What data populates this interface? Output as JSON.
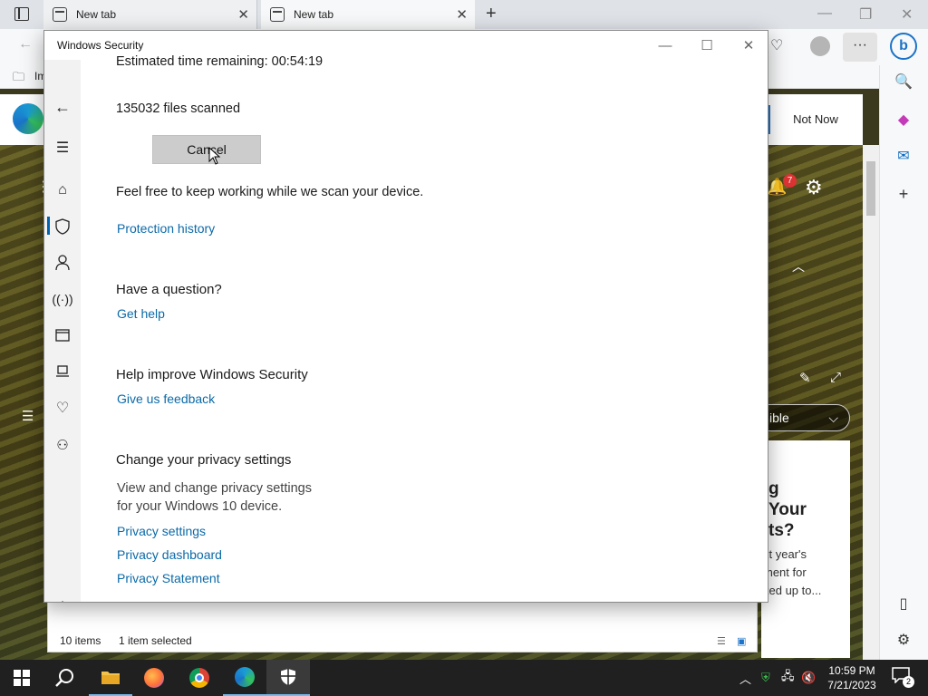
{
  "browser": {
    "tabs": [
      {
        "label": "New tab"
      },
      {
        "label": "New tab"
      }
    ],
    "fav_fragment": "Im",
    "banner_button": "Not Now",
    "notification_count": "7",
    "visible_pill": "ible",
    "news": {
      "title": "g\nYour\nts?",
      "subtitle": "xt year's\nment for\nked up to..."
    }
  },
  "explorer_status": {
    "items": "10 items",
    "selected": "1 item selected"
  },
  "dialog": {
    "title": "Windows Security",
    "scan": {
      "time_remaining": "Estimated time remaining: 00:54:19",
      "files_scanned": "135032  files scanned",
      "cancel_label": "Cancel",
      "keep_working": "Feel free to keep working while we scan your device.",
      "protection_history": "Protection history"
    },
    "question": {
      "heading": "Have a question?",
      "link": "Get help"
    },
    "improve": {
      "heading": "Help improve Windows Security",
      "link": "Give us feedback"
    },
    "privacy": {
      "heading": "Change your privacy settings",
      "description": "View and change privacy settings\nfor your Windows 10 device.",
      "links": [
        "Privacy settings",
        "Privacy dashboard",
        "Privacy Statement"
      ]
    }
  },
  "taskbar": {
    "time": "10:59 PM",
    "date": "7/21/2023",
    "notification_count": "2"
  },
  "colors": {
    "link": "#0b6aa8",
    "accent": "#0063b1",
    "taskbar": "#202020"
  }
}
